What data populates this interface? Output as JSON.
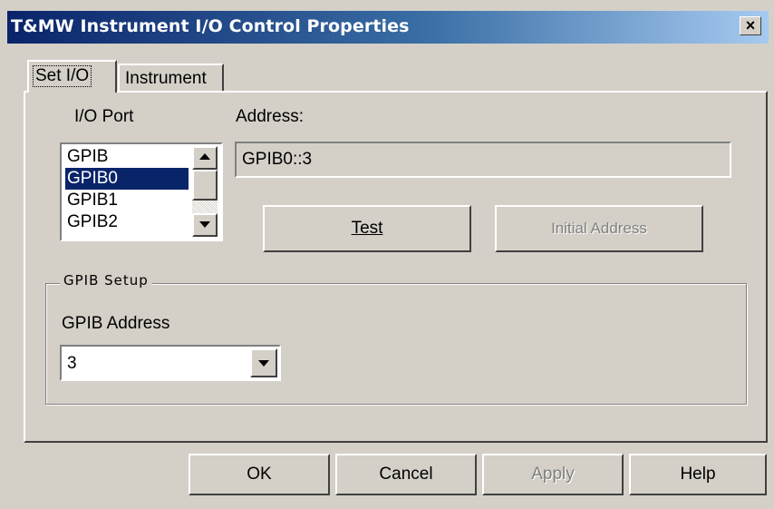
{
  "window": {
    "title": "T&MW Instrument I/O Control Properties",
    "close_label": "×"
  },
  "tabs": [
    {
      "label": "Set I/O",
      "active": true
    },
    {
      "label": "Instrument",
      "active": false
    }
  ],
  "io_port": {
    "label": "I/O Port",
    "items": [
      "GPIB",
      "GPIB0",
      "GPIB1",
      "GPIB2"
    ],
    "selected": "GPIB0"
  },
  "address": {
    "label": "Address:",
    "value": "GPIB0::3"
  },
  "buttons": {
    "test": "Test",
    "initial_address": "Initial Address"
  },
  "gpib_setup": {
    "caption": "GPIB Setup",
    "address_label": "GPIB Address",
    "address_value": "3"
  },
  "footer": {
    "ok": "OK",
    "cancel": "Cancel",
    "apply": "Apply",
    "help": "Help"
  },
  "icons": {
    "scroll_up": "up-arrow-icon",
    "scroll_down": "down-arrow-icon",
    "dropdown": "chevron-down-icon",
    "close": "close-icon"
  },
  "colors": {
    "titlebar_start": "#0a246a",
    "titlebar_end": "#a6caf0",
    "selection": "#0a246a",
    "face": "#d4d0c8"
  }
}
